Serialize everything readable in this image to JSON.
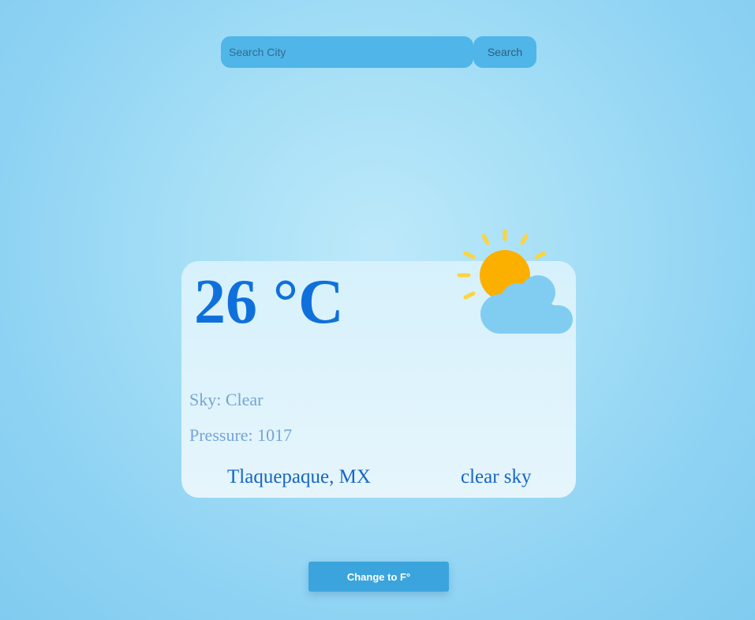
{
  "search": {
    "placeholder": "Search City",
    "value": "",
    "button_label": "Search"
  },
  "weather": {
    "temperature": "26 °C",
    "sky": "Sky: Clear",
    "pressure": "Pressure: 1017",
    "location": "Tlaquepaque, MX",
    "description": "clear sky",
    "icon": "partly-cloudy-icon"
  },
  "toggle": {
    "label": "Change to F°"
  },
  "colors": {
    "accent": "#50b5e8",
    "temperature": "#0f70dc",
    "sun": "#fbb000",
    "cloud": "#81cdf1",
    "toggle": "#3ba4dc"
  }
}
